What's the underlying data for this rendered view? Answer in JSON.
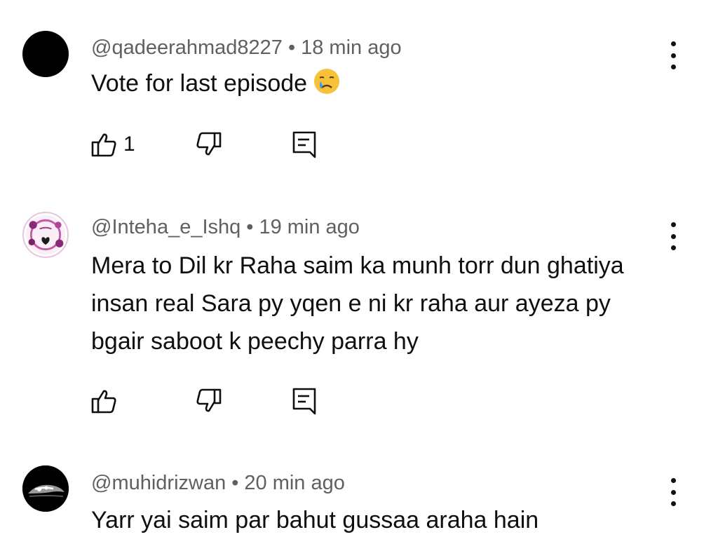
{
  "comments": [
    {
      "handle": "@qadeerahmad8227",
      "separator": "•",
      "time": "18 min ago",
      "text": "Vote for last episode",
      "emoji": "crying-face-emoji",
      "like_count": "1",
      "avatar": "black-circle-avatar"
    },
    {
      "handle": "@Inteha_e_Ishq",
      "separator": "•",
      "time": "19 min ago",
      "text_lines": [
        "Mera to Dil kr Raha saim ka munh torr dun ghatiya",
        "insan real Sara py yqen e ni kr raha aur ayeza py",
        "bgair saboot k peechy parra hy"
      ],
      "like_count": "",
      "avatar": "pink-heart-logo-avatar"
    },
    {
      "handle": "@muhidrizwan",
      "separator": "•",
      "time": "20 min ago",
      "text": "Yarr yai saim par bahut gussaa araha hain",
      "avatar": "car-headlight-avatar"
    }
  ],
  "colors": {
    "text": "#0f0f0f",
    "meta": "#606060",
    "background": "#ffffff"
  }
}
